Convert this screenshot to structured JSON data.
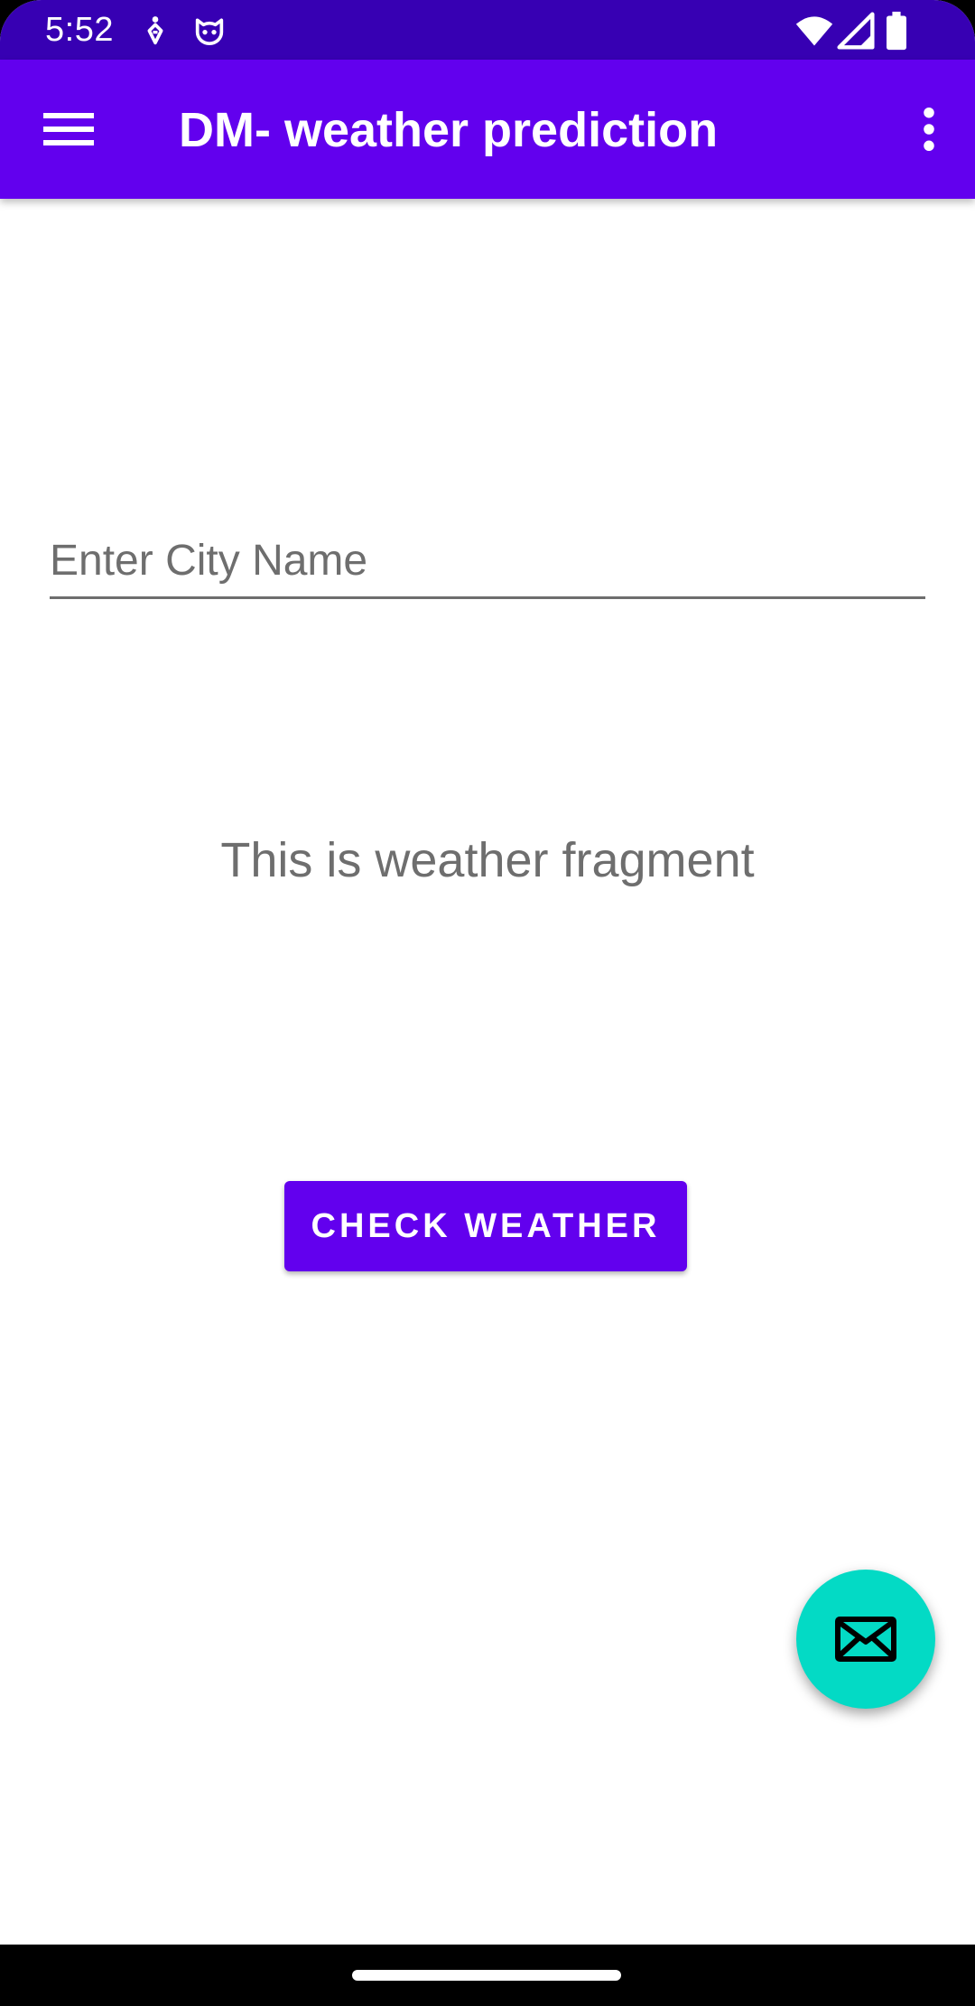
{
  "status_bar": {
    "time": "5:52",
    "left_icons": [
      "accessibility-icon",
      "cat-face-icon"
    ],
    "right_icons": [
      "wifi-icon",
      "cell-signal-icon",
      "battery-icon"
    ],
    "background_color": "#3700B3"
  },
  "app_bar": {
    "title": "DM- weather prediction",
    "menu_icon": "hamburger-menu-icon",
    "overflow_icon": "more-vert-icon",
    "background_color": "#6200EE"
  },
  "main": {
    "city_input": {
      "placeholder": "Enter City Name",
      "value": ""
    },
    "fragment_text": "This is weather fragment",
    "check_button_label": "CHECK WEATHER",
    "accent_color": "#6200EE"
  },
  "fab": {
    "icon": "mail-icon",
    "background_color": "#03DAC5"
  }
}
